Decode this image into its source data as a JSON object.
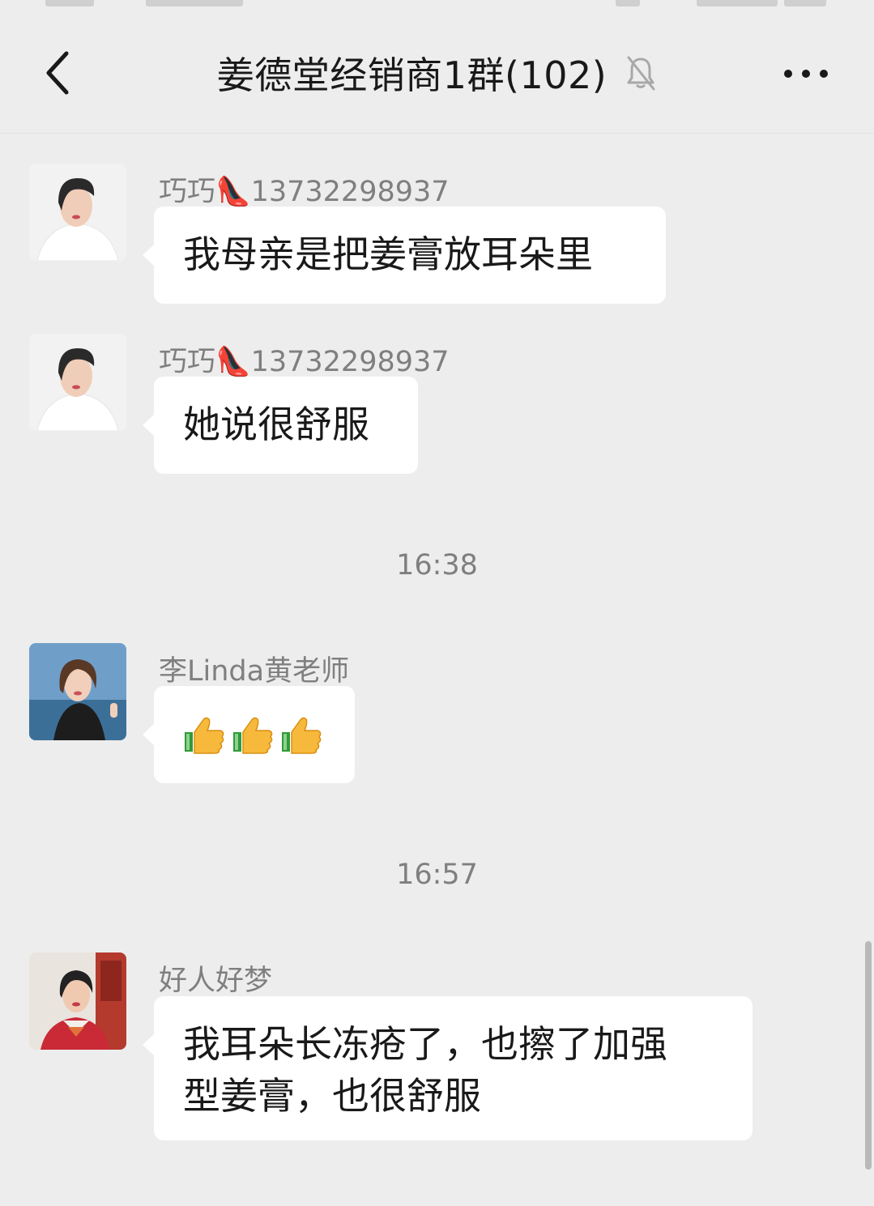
{
  "header": {
    "title": "姜德堂经销商1群(102)",
    "icons": [
      "back-chevron-icon",
      "mute-bell-icon",
      "more-dots-icon"
    ]
  },
  "messages": [
    {
      "sender": "巧巧👠13732298937",
      "text": "我母亲是把姜膏放耳朵里"
    },
    {
      "sender": "巧巧👠13732298937",
      "text": "她说很舒服"
    },
    {
      "sender": "李Linda黄老师",
      "emoji": [
        "thumbs-up-icon",
        "thumbs-up-icon",
        "thumbs-up-icon"
      ]
    },
    {
      "sender": "好人好梦",
      "text_line1": "我耳朵长冻疮了，也擦了加强",
      "text_line2": "型姜膏，也很舒服"
    }
  ],
  "timestamps": [
    "16:38",
    "16:57"
  ],
  "colors": {
    "background": "#ededed",
    "bubble": "#ffffff",
    "text": "#191919",
    "meta": "#7f7f7f"
  }
}
